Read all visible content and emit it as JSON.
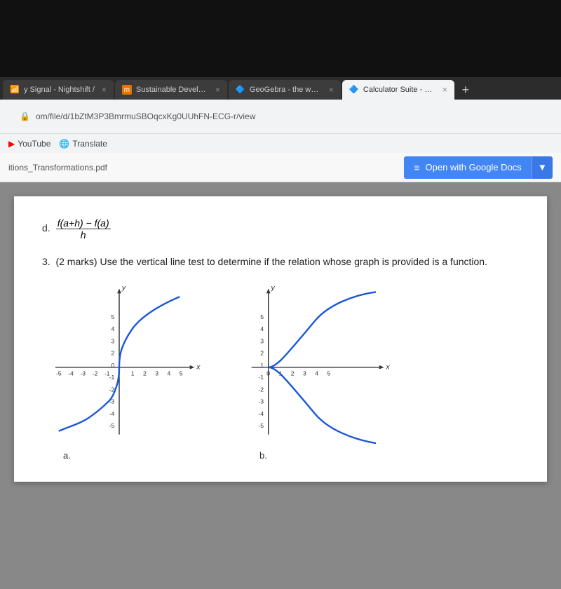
{
  "bezel": {
    "height": 110
  },
  "browser": {
    "tabs": [
      {
        "label": "y Signal - Nightshift /",
        "active": false,
        "favicon": "📶"
      },
      {
        "label": "Sustainable Development",
        "active": false,
        "favicon": "M"
      },
      {
        "label": "GeoGebra - the world's fa",
        "active": false,
        "favicon": "🔷"
      },
      {
        "label": "Calculator Suite - GeoGe",
        "active": true,
        "favicon": "🔷"
      }
    ],
    "address": "om/file/d/1bZtM3P3BmrmuSBOqcxKg0UUhFN-ECG-r/view",
    "bookmarks": [
      {
        "label": "YouTube",
        "favicon": "▶"
      },
      {
        "label": "Translate",
        "favicon": "🌐"
      }
    ]
  },
  "toolbar": {
    "filename": "itions_Transformations.pdf",
    "open_with_label": "Open with Google Docs",
    "open_with_icon": "≡",
    "dropdown_arrow": "▼"
  },
  "pdf": {
    "formula_label": "d.",
    "formula_numerator": "f(a+h) − f(a)",
    "formula_denominator": "h",
    "question_number": "3.",
    "question_text": "(2 marks) Use the vertical line test to determine if the relation whose graph is provided is a function.",
    "graph_a_label": "a.",
    "graph_b_label": "b."
  }
}
